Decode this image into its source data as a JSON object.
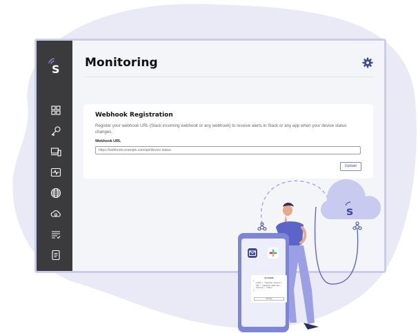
{
  "app": {
    "logo_letter": "S",
    "brand_color": "#3f4a9e"
  },
  "header": {
    "title": "Monitoring",
    "settings_icon": "gear-icon"
  },
  "sidebar": {
    "items": [
      {
        "icon": "dashboard-icon"
      },
      {
        "icon": "key-icon"
      },
      {
        "icon": "devices-icon"
      },
      {
        "icon": "monitoring-icon"
      },
      {
        "icon": "globe-icon"
      },
      {
        "icon": "cloud-sync-icon"
      },
      {
        "icon": "list-icon"
      },
      {
        "icon": "document-icon"
      }
    ]
  },
  "webhook": {
    "title": "Webhook Registration",
    "description": "Register your webhook URL (Slack incoming webhook or any webhook) to receive alerts in Slack or any app when your device status changes.",
    "url_label": "Webhook URL",
    "url_placeholder": "https://webhook.example.com/api/device-status",
    "update_label": "Update"
  },
  "phone": {
    "card_title": "Socket99",
    "card_code": "{\n  \"name\": \"Thermal Sensor\",\n  \"ID\": \"webhook-a52f-0e\",\n  \"status\": \"down\"\n}",
    "card_button": "Dismiss"
  },
  "colors": {
    "sidebar": "#3b3b3d",
    "accent": "#7d85d8",
    "blob": "#e9eaf6"
  }
}
